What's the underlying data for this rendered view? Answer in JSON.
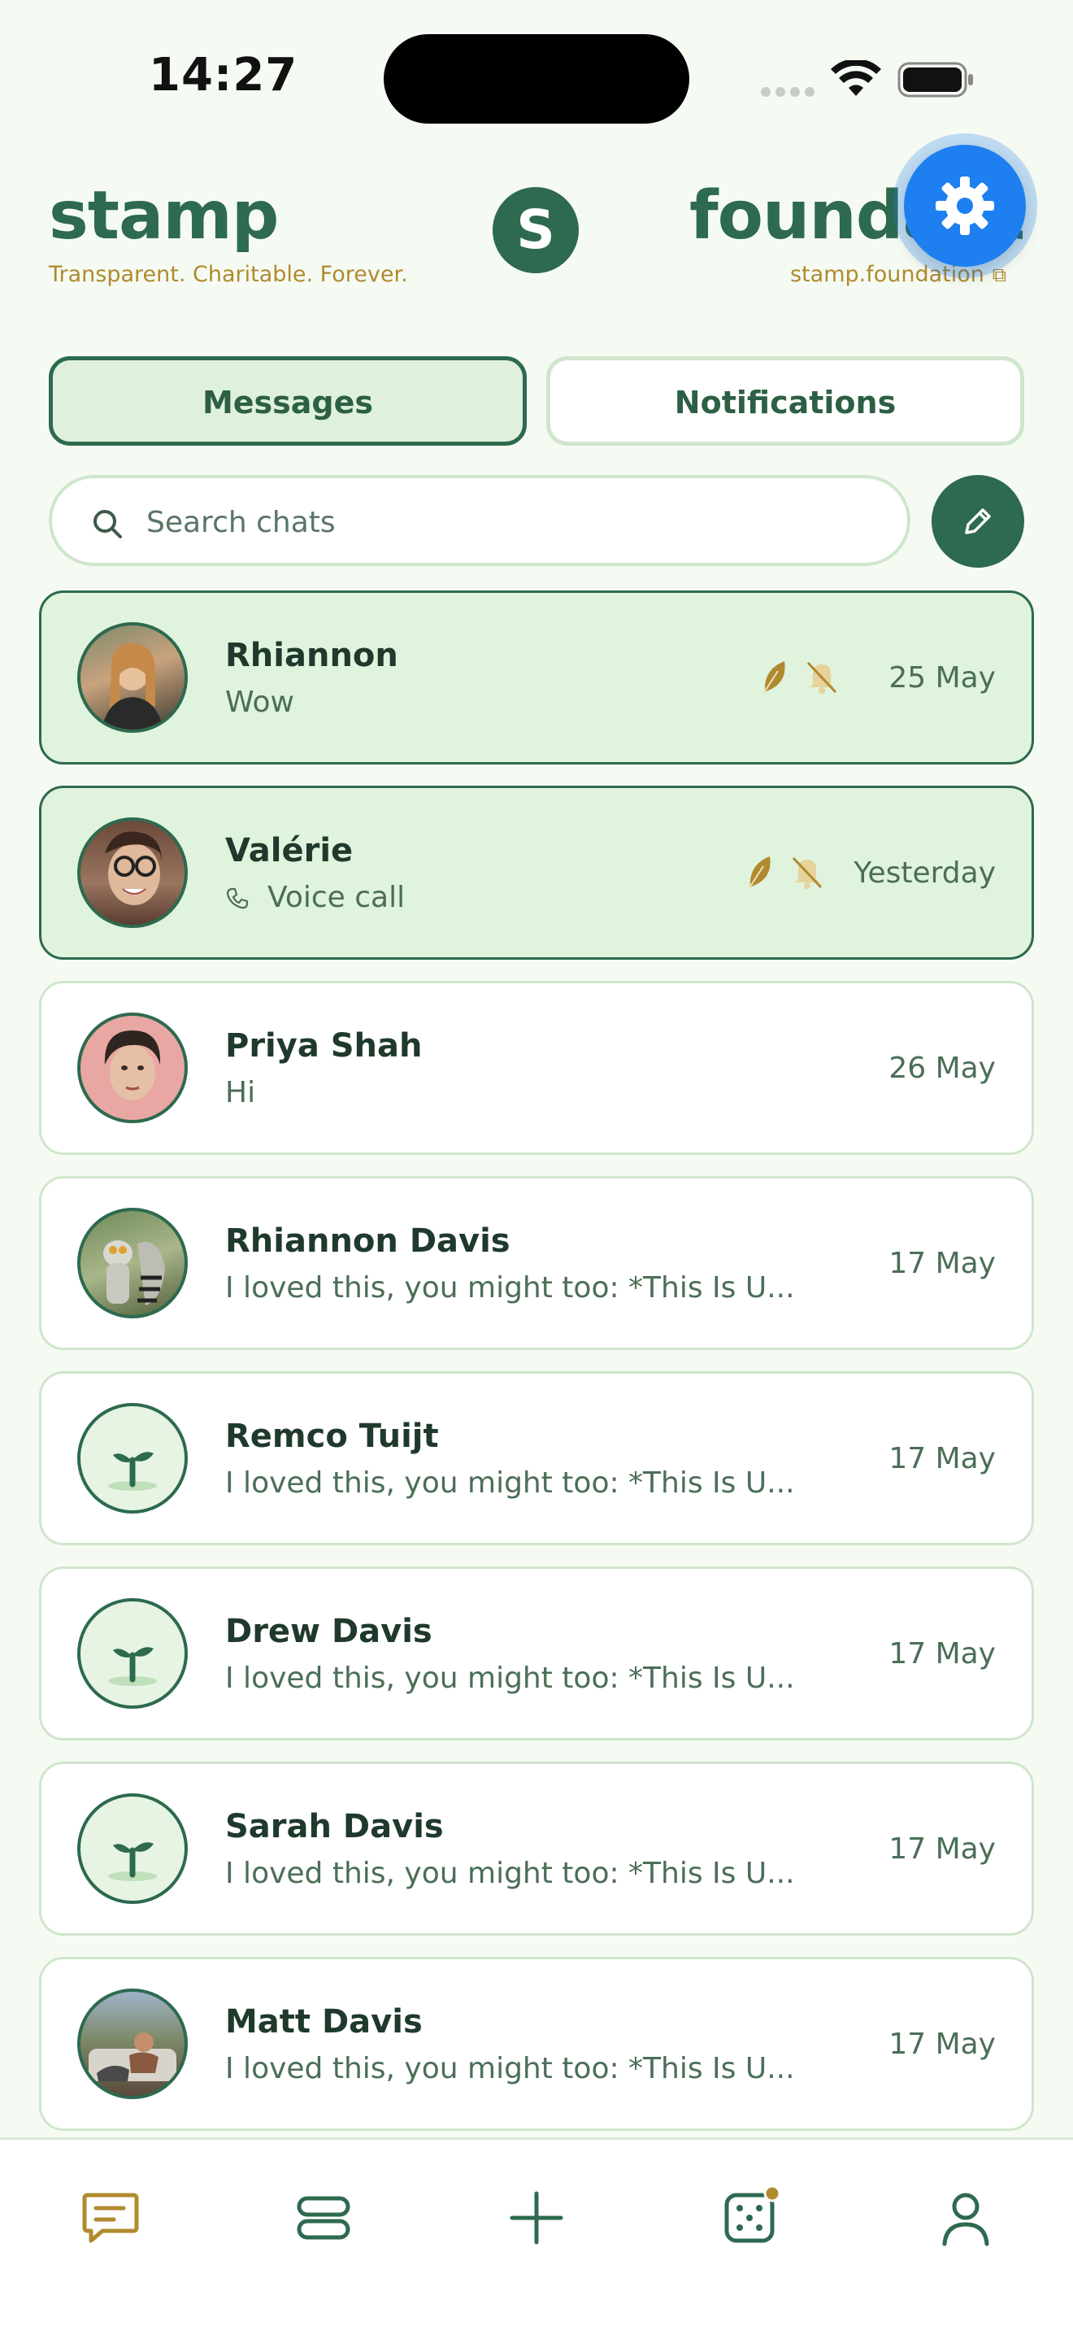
{
  "status_bar": {
    "time": "14:27"
  },
  "header": {
    "brand_left": "stamp",
    "tagline": "Transparent. Charitable. Forever.",
    "logo_letter": "S",
    "brand_right": "foundation",
    "site_link": "stamp.foundation"
  },
  "tabs": {
    "messages": "Messages",
    "notifications": "Notifications",
    "active": "messages"
  },
  "search": {
    "placeholder": "Search chats",
    "value": ""
  },
  "chats": [
    {
      "name": "Rhiannon",
      "preview": "Wow",
      "date": "25 May",
      "highlighted": true,
      "muted": true,
      "avatar": "photo"
    },
    {
      "name": "Valérie",
      "preview": "Voice call",
      "date": "Yesterday",
      "highlighted": true,
      "muted": true,
      "avatar": "photo",
      "preview_icon": "phone-icon"
    },
    {
      "name": "Priya Shah",
      "preview": "Hi",
      "date": "26 May",
      "highlighted": false,
      "avatar": "photo"
    },
    {
      "name": "Rhiannon Davis",
      "preview": "I loved this, you might too: *This Is U...",
      "date": "17 May",
      "highlighted": false,
      "avatar": "photo"
    },
    {
      "name": "Remco Tuijt",
      "preview": "I loved this, you might too: *This Is U...",
      "date": "17 May",
      "highlighted": false,
      "avatar": "sprout"
    },
    {
      "name": "Drew Davis",
      "preview": "I loved this, you might too: *This Is U...",
      "date": "17 May",
      "highlighted": false,
      "avatar": "sprout"
    },
    {
      "name": "Sarah Davis",
      "preview": "I loved this, you might too: *This Is U...",
      "date": "17 May",
      "highlighted": false,
      "avatar": "sprout"
    },
    {
      "name": "Matt Davis",
      "preview": "I loved this, you might too: *This Is U...",
      "date": "17 May",
      "highlighted": false,
      "avatar": "photo"
    }
  ],
  "bottom_nav": [
    "messages-icon",
    "feed-icon",
    "add-icon",
    "dice-icon",
    "profile-icon"
  ],
  "colors": {
    "primary": "#2d6a4f",
    "accent": "#b08a2e",
    "highlight_bg": "#e0f3dd",
    "gear_blue": "#1e7ff0"
  }
}
